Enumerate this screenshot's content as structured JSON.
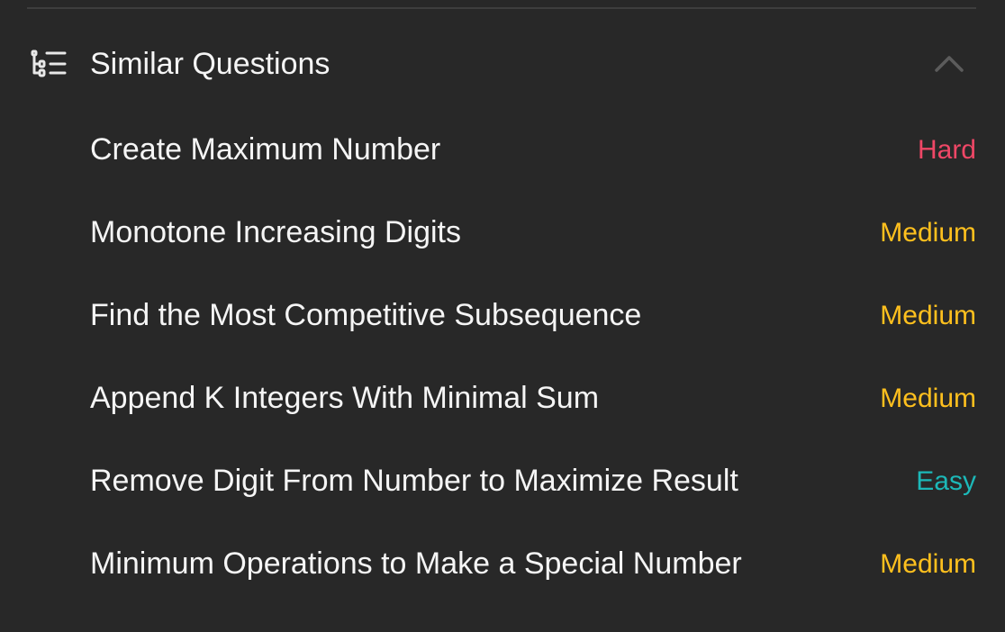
{
  "colors": {
    "background": "#282828",
    "text": "#f5f5f5",
    "divider": "#3e3e3e",
    "icon": "#e8e8e8",
    "chevron": "#5c5c5c",
    "hard": "#ef4766",
    "medium": "#ffc01e",
    "easy": "#1cb8b8"
  },
  "section": {
    "title": "Similar Questions",
    "icon": "list-tree-icon",
    "toggle_icon": "chevron-up-icon"
  },
  "questions": [
    {
      "title": "Create Maximum Number",
      "difficulty": "Hard",
      "level": "hard"
    },
    {
      "title": "Monotone Increasing Digits",
      "difficulty": "Medium",
      "level": "medium"
    },
    {
      "title": "Find the Most Competitive Subsequence",
      "difficulty": "Medium",
      "level": "medium"
    },
    {
      "title": "Append K Integers With Minimal Sum",
      "difficulty": "Medium",
      "level": "medium"
    },
    {
      "title": "Remove Digit From Number to Maximize Result",
      "difficulty": "Easy",
      "level": "easy"
    },
    {
      "title": "Minimum Operations to Make a Special Number",
      "difficulty": "Medium",
      "level": "medium"
    }
  ]
}
